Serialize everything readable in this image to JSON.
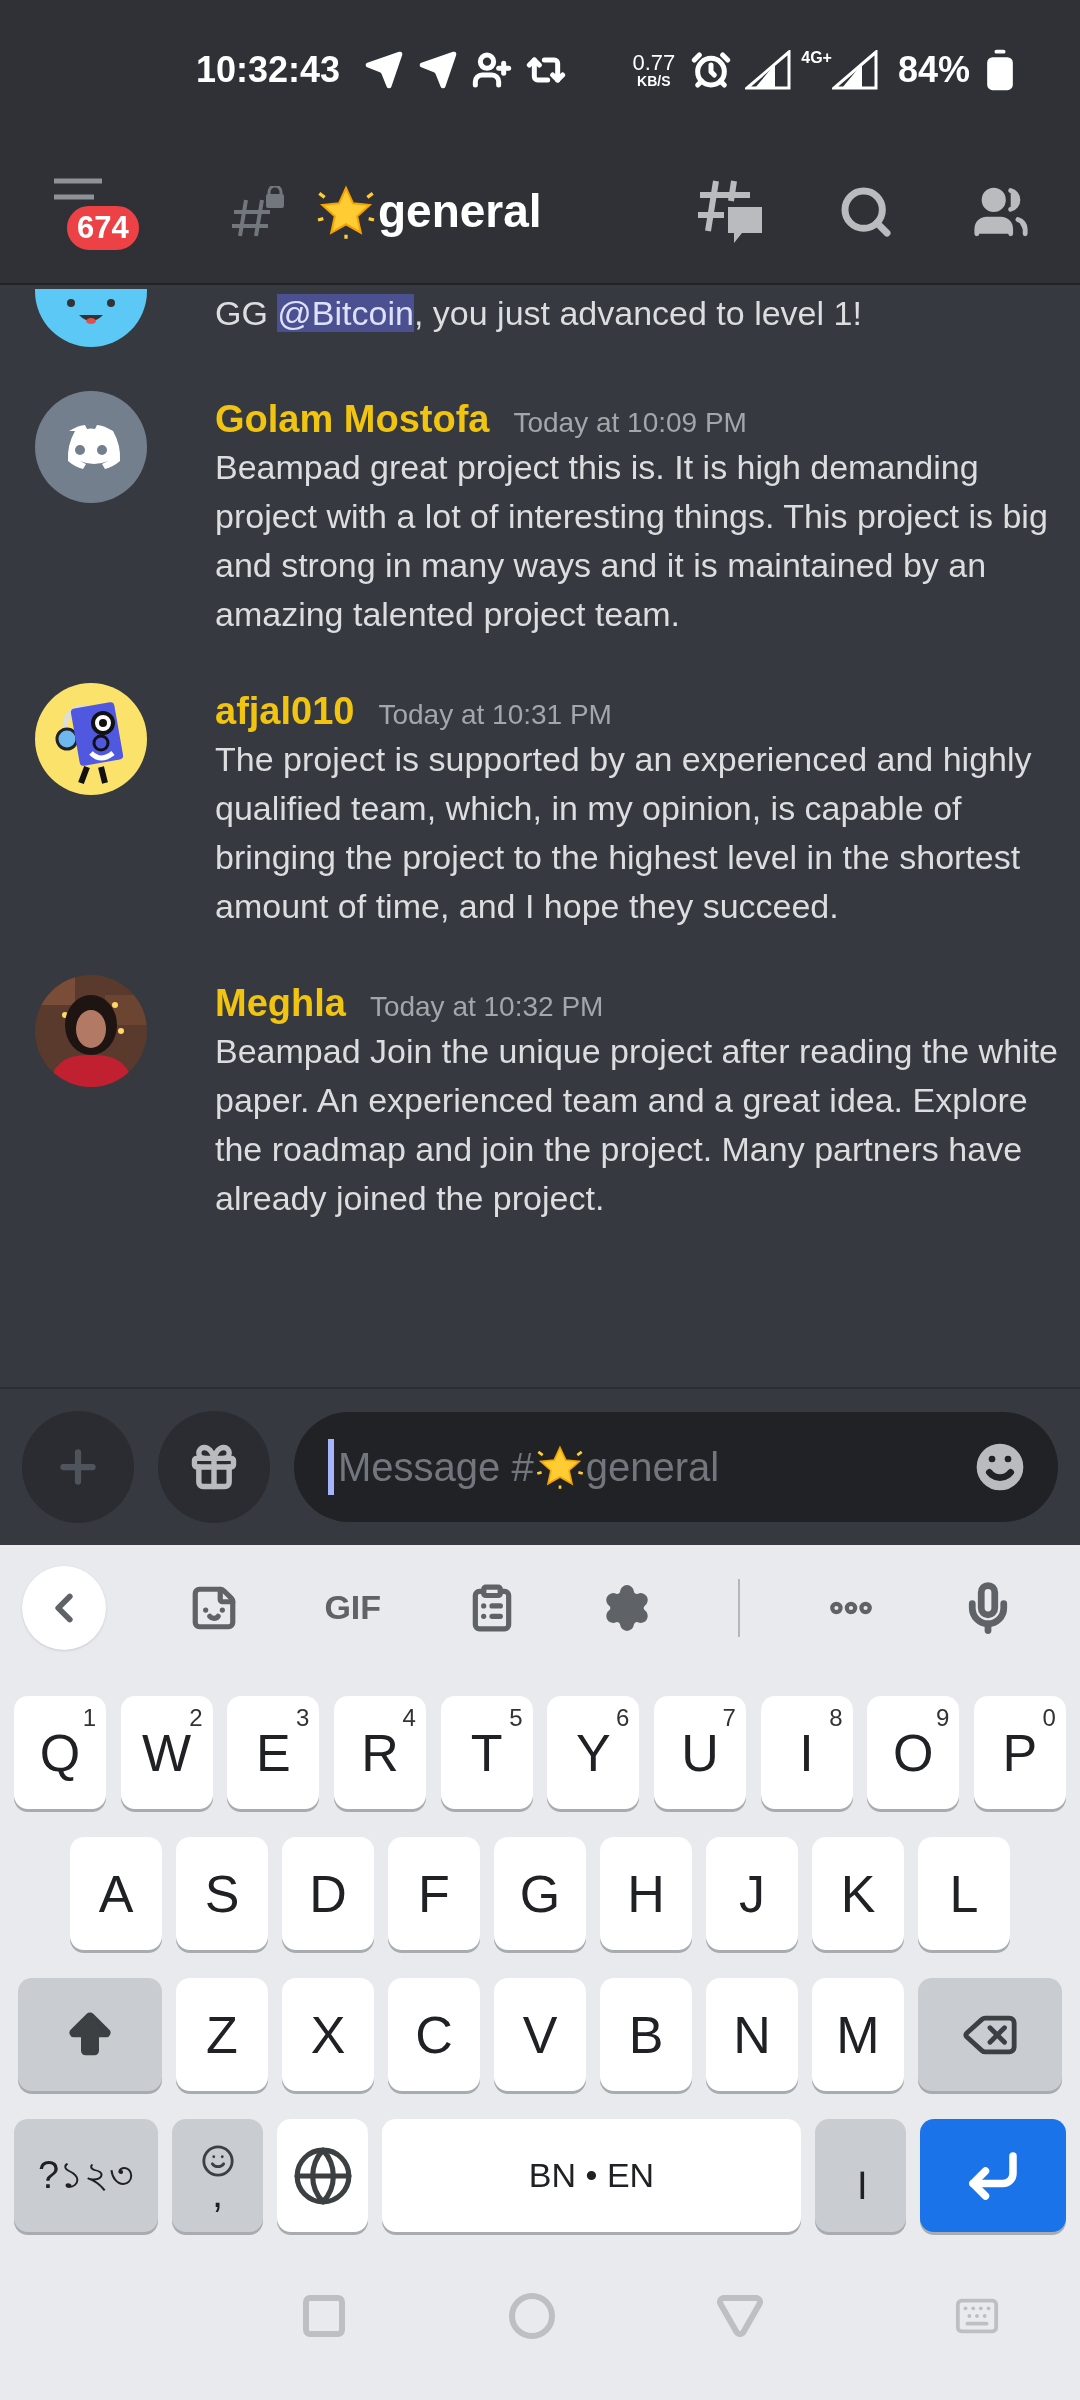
{
  "status_bar": {
    "time": "10:32:43",
    "speed": "0.77",
    "speed_unit": "KB/S",
    "network": "4G+",
    "battery": "84%"
  },
  "header": {
    "unread_badge": "674",
    "channel": "general"
  },
  "messages": [
    {
      "kind": "partial",
      "avatar": {
        "kind": "blue"
      },
      "parts": [
        {
          "kind": "plain",
          "text": "GG "
        },
        {
          "kind": "mention",
          "text": "@Bitcoin"
        },
        {
          "kind": "plain",
          "text": ", you just advanced to level 1!"
        }
      ]
    },
    {
      "kind": "full",
      "avatar": {
        "kind": "discord"
      },
      "author": "Golam Mostofa",
      "time": "Today at 10:09 PM",
      "text": "Beampad great project this is. It is high demanding project with a lot of interesting things. This project is big and strong in many ways and it is maintained by an amazing talented project team."
    },
    {
      "kind": "full",
      "avatar": {
        "kind": "robot"
      },
      "author": "afjal010",
      "time": "Today at 10:31 PM",
      "text": "The project is supported by an experienced and highly qualified team, which, in my opinion, is capable of bringing the project to the highest level in the shortest amount of time, and I hope they succeed."
    },
    {
      "kind": "full",
      "author": "Meghla",
      "time": "Today at 10:32 PM",
      "text": "Beampad Join the unique project after reading the white paper. An experienced team and a great idea. Explore the roadmap and join the project. Many partners have already joined the project."
    }
  ],
  "composer": {
    "placeholder_prefix": "Message #",
    "placeholder_channel": "general"
  },
  "keyboard_toolbar": {
    "gif": "GIF"
  },
  "keyboard_rows": [
    [
      {
        "kind": "char",
        "label": "Q",
        "hint": "1"
      },
      {
        "kind": "char",
        "label": "W",
        "hint": "2"
      },
      {
        "kind": "char",
        "label": "E",
        "hint": "3"
      },
      {
        "kind": "char",
        "label": "R",
        "hint": "4"
      },
      {
        "kind": "char",
        "label": "T",
        "hint": "5"
      },
      {
        "kind": "char",
        "label": "Y",
        "hint": "6"
      },
      {
        "kind": "char",
        "label": "U",
        "hint": "7"
      },
      {
        "kind": "char",
        "label": "I",
        "hint": "8"
      },
      {
        "kind": "char",
        "label": "O",
        "hint": "9"
      },
      {
        "kind": "char",
        "label": "P",
        "hint": "0"
      }
    ],
    [
      {
        "kind": "char",
        "label": "A"
      },
      {
        "kind": "char",
        "label": "S"
      },
      {
        "kind": "char",
        "label": "D"
      },
      {
        "kind": "char",
        "label": "F"
      },
      {
        "kind": "char",
        "label": "G"
      },
      {
        "kind": "char",
        "label": "H"
      },
      {
        "kind": "char",
        "label": "J"
      },
      {
        "kind": "char",
        "label": "K"
      },
      {
        "kind": "char",
        "label": "L"
      }
    ],
    [
      {
        "kind": "shift"
      },
      {
        "kind": "char",
        "label": "Z"
      },
      {
        "kind": "char",
        "label": "X"
      },
      {
        "kind": "char",
        "label": "C"
      },
      {
        "kind": "char",
        "label": "V"
      },
      {
        "kind": "char",
        "label": "B"
      },
      {
        "kind": "char",
        "label": "N"
      },
      {
        "kind": "char",
        "label": "M"
      },
      {
        "kind": "backspace"
      }
    ],
    [
      {
        "kind": "symbols",
        "label": "?১২৩"
      },
      {
        "kind": "emoji",
        "label": ","
      },
      {
        "kind": "globe"
      },
      {
        "kind": "space",
        "label": "BN • EN"
      },
      {
        "kind": "punct",
        "label": "।"
      },
      {
        "kind": "enter"
      }
    ]
  ]
}
